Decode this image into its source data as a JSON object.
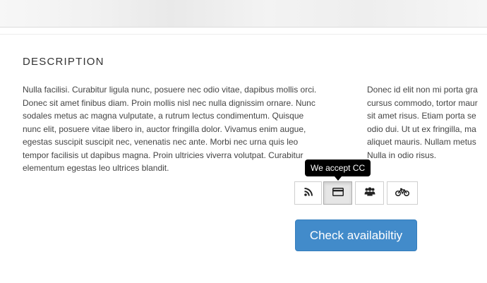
{
  "section": {
    "title": "DESCRIPTION"
  },
  "description": {
    "left": "Nulla facilisi. Curabitur ligula nunc, posuere nec odio vitae, dapibus mollis orci.\nDonec sit amet finibus diam. Proin mollis nisl nec nulla dignissim ornare. Nunc\nsodales metus ac magna vulputate, a rutrum lectus condimentum. Quisque\nnunc elit, posuere vitae libero in, auctor fringilla dolor. Vivamus enim augue,\negestas suscipit suscipit nec, venenatis nec ante. Morbi nec urna quis leo\ntempor facilisis ut dapibus magna. Proin ultricies viverra volutpat. Curabitur\nelementum egestas leo ultrices blandit.",
    "right": "Donec id elit non mi porta gra\ncursus commodo, tortor maur\nsit amet risus. Etiam porta se\nodio dui. Ut ut ex fringilla, ma\naliquet mauris. Nullam metus\nNulla in odio risus."
  },
  "tooltip": {
    "text": "We accept CC"
  },
  "amenities": {
    "icons": [
      "rss-icon",
      "credit-card-icon",
      "users-icon",
      "bicycle-icon"
    ],
    "active_index": 1
  },
  "actions": {
    "check_label": "Check availabiltiy"
  },
  "colors": {
    "primary": "#428bca",
    "tooltip_bg": "#000000"
  }
}
